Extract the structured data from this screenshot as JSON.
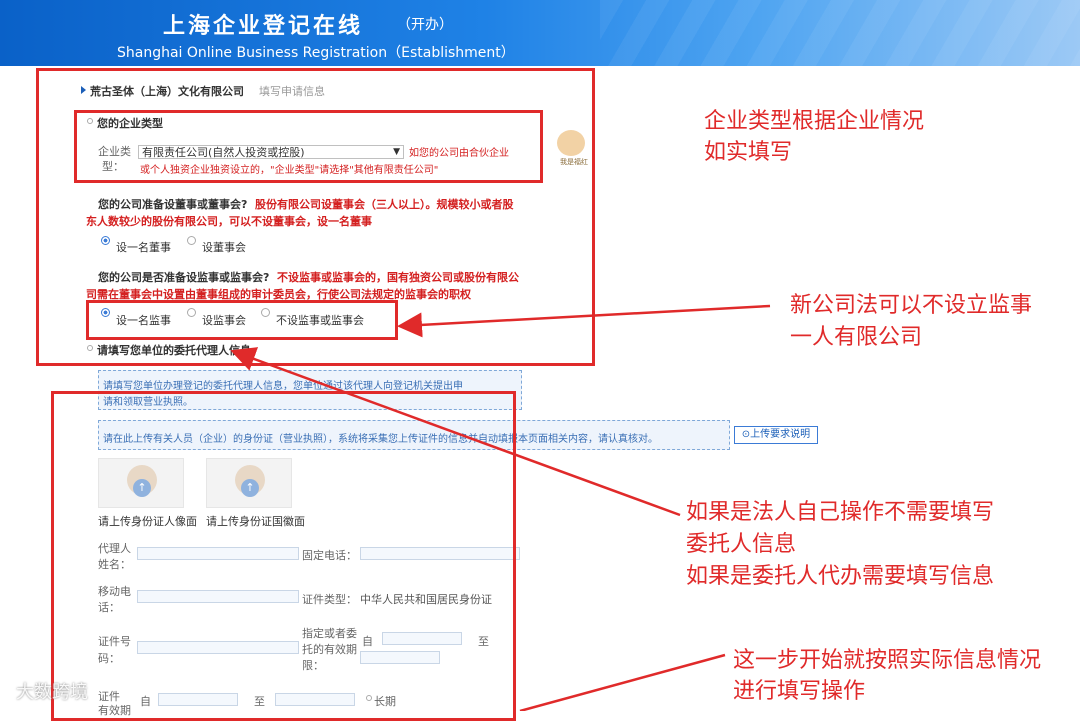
{
  "banner": {
    "title": "上海企业登记在线",
    "title_tag": "（开办）",
    "subtitle": "Shanghai Online Business Registration（Establishment）"
  },
  "company": {
    "name": "荒古圣体（上海）文化有限公司",
    "hint": "填写申请信息"
  },
  "enterprise_type": {
    "section_title": "您的企业类型",
    "label_line1": "企业类",
    "label_line2": "型：",
    "selected": "有限责任公司(自然人投资或控股)",
    "note_line1": "如您的公司由合伙企业",
    "note_line2": "或个人独资企业独资设立的，\"企业类型\"请选择\"其他有限责任公司\"",
    "mascot_label": "我是福红"
  },
  "board": {
    "question": "您的公司准备设董事或董事会?",
    "note_line1": "股份有限公司设董事会（三人以上）。规模较小或者股",
    "note_line2": "东人数较少的股份有限公司，可以不设董事会，设一名董事",
    "options": [
      "设一名董事",
      "设董事会"
    ]
  },
  "supervisor": {
    "question": "您的公司是否准备设监事或监事会?",
    "note_line1": "不设监事或监事会的，国有独资公司或股份有限公",
    "note_line2": "司需在董事会中设置由董事组成的审计委员会，行使公司法规定的监事会的职权",
    "options": [
      "设一名监事",
      "设监事会",
      "不设监事或监事会"
    ]
  },
  "agent": {
    "section_title": "请填写您单位的委托代理人信息",
    "info_line1": "请填写您单位办理登记的委托代理人信息，您单位通过该代理人向登记机关提出申",
    "info_line2": "请和领取营业执照。",
    "upload_info": "请在此上传有关人员（企业）的身份证（营业执照），系统将采集您上传证件的信息并自动填报本页面相关内容，请认真核对。",
    "upload_help_button": "⊙上传要求说明",
    "upload_front_label": "请上传身份证人像面",
    "upload_back_label": "请上传身份证国徽面",
    "name_label_1": "代理人",
    "name_label_2": "姓名：",
    "phone_label": "固定电话：",
    "mobile_label_1": "移动电",
    "mobile_label_2": "话：",
    "cert_type_label": "证件类型：",
    "cert_type_value": "中华人民共和国居民身份证",
    "cert_no_label_1": "证件号",
    "cert_no_label_2": "码：",
    "validity_label_1": "指定或者委",
    "validity_label_2": "托的有效期",
    "validity_label_3": "限：",
    "from_label": "自",
    "to_label": "至",
    "id_validity_label_1": "证件",
    "id_validity_label_2": "有效期",
    "long_term_label": "长期"
  },
  "annotations": {
    "type_line1": "企业类型根据企业情况",
    "type_line2": "如实填写",
    "supervisor_line1": "新公司法可以不设立监事",
    "supervisor_line2": "一人有限公司",
    "agent_line1": "如果是法人自己操作不需要填写",
    "agent_line2": "委托人信息",
    "agent_line3": "如果是委托人代办需要填写信息",
    "step_line1": "这一步开始就按照实际信息情况",
    "step_line2": "进行填写操作"
  },
  "watermark": "大数跨境",
  "colors": {
    "banner_blue": "#0a61c8",
    "annotation_red": "#e02a2a",
    "note_red": "#d42020",
    "accent_blue": "#3b7bd6"
  }
}
